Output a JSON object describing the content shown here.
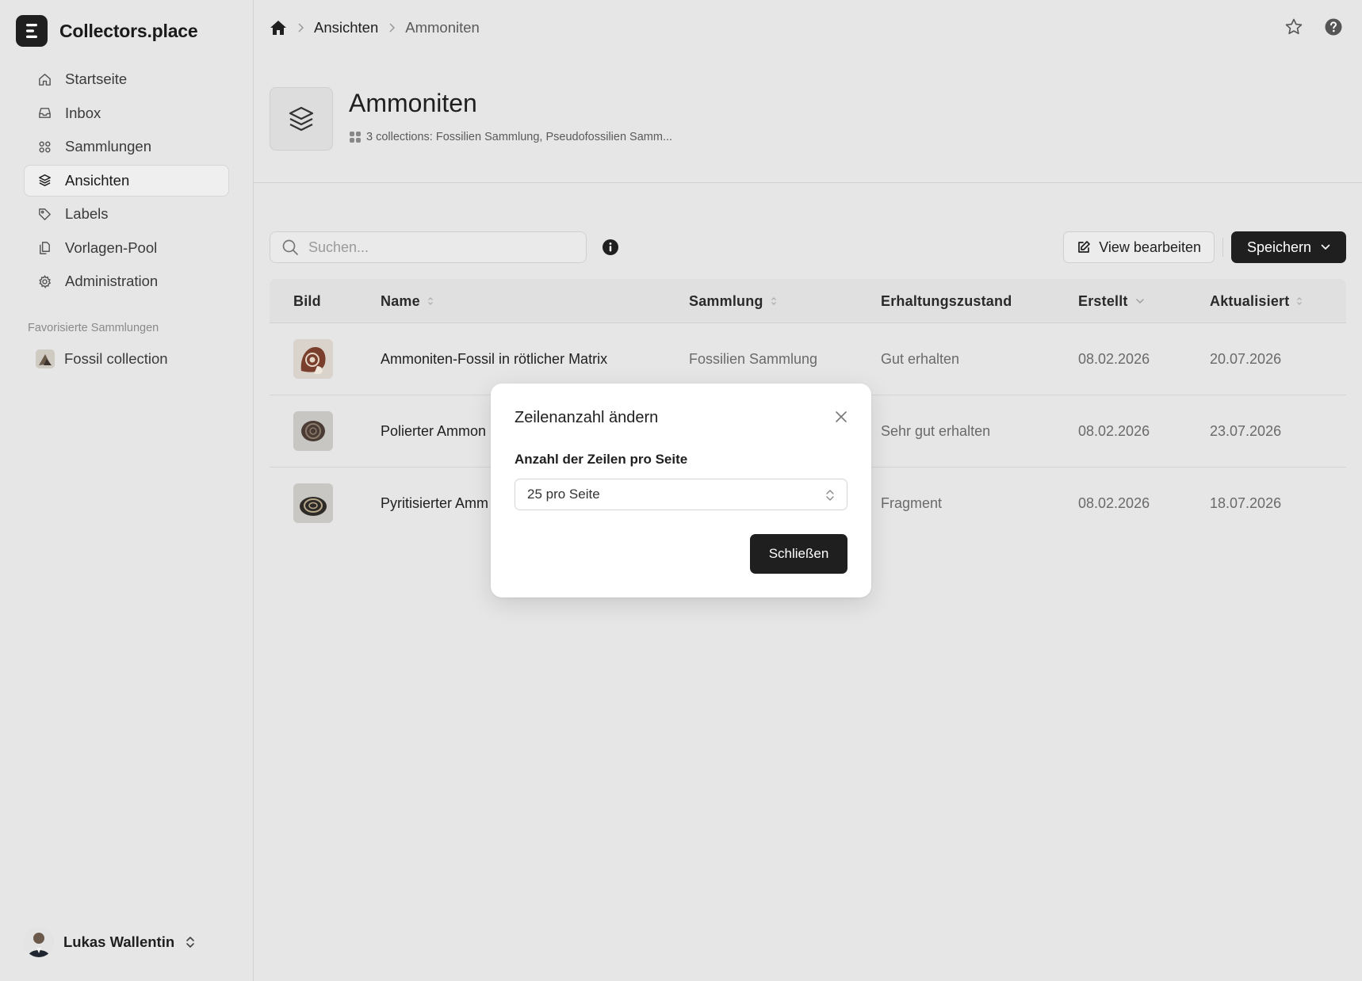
{
  "app": {
    "name": "Collectors.place"
  },
  "sidebar": {
    "items": [
      {
        "label": "Startseite",
        "icon": "home-icon"
      },
      {
        "label": "Inbox",
        "icon": "inbox-icon"
      },
      {
        "label": "Sammlungen",
        "icon": "grid-icon"
      },
      {
        "label": "Ansichten",
        "icon": "layers-icon",
        "active": true
      },
      {
        "label": "Labels",
        "icon": "tag-icon"
      },
      {
        "label": "Vorlagen-Pool",
        "icon": "copy-icon"
      },
      {
        "label": "Administration",
        "icon": "gear-icon"
      }
    ],
    "favorites_title": "Favorisierte Sammlungen",
    "favorites": [
      {
        "label": "Fossil collection"
      }
    ],
    "user": {
      "name": "Lukas Wallentin"
    }
  },
  "breadcrumb": {
    "items": [
      "Ansichten",
      "Ammoniten"
    ]
  },
  "page": {
    "title": "Ammoniten",
    "subtitle": "3 collections: Fossilien Sammlung, Pseudofossilien Samm..."
  },
  "toolbar": {
    "search_placeholder": "Suchen...",
    "edit_label": "View bearbeiten",
    "save_label": "Speichern"
  },
  "table": {
    "columns": [
      "Bild",
      "Name",
      "Sammlung",
      "Erhaltungszustand",
      "Erstellt",
      "Aktualisiert"
    ],
    "rows": [
      {
        "name": "Ammoniten-Fossil in rötlicher Matrix",
        "collection": "Fossilien Sammlung",
        "condition": "Gut erhalten",
        "created": "08.02.2026",
        "updated": "20.07.2026"
      },
      {
        "name": "Polierter Ammon",
        "collection": "",
        "condition": "Sehr gut erhalten",
        "created": "08.02.2026",
        "updated": "23.07.2026"
      },
      {
        "name": "Pyritisierter Amm",
        "collection": "",
        "condition": "Fragment",
        "created": "08.02.2026",
        "updated": "18.07.2026"
      }
    ]
  },
  "modal": {
    "title": "Zeilenanzahl ändern",
    "label": "Anzahl der Zeilen pro Seite",
    "select_value": "25 pro Seite",
    "close_label": "Schließen"
  },
  "colors": {
    "accent": "#1f1f1f",
    "background": "#e6e6e6"
  }
}
